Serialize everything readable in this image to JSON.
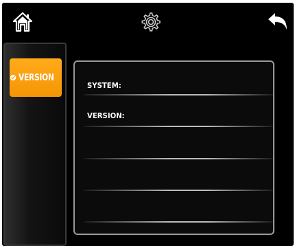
{
  "topbar": {
    "home_icon": "home-icon",
    "settings_icon": "gear-icon",
    "back_icon": "back-arrow-icon"
  },
  "sidebar": {
    "items": [
      {
        "label": "VERSION",
        "icon": "check-badge-icon",
        "selected": true
      }
    ]
  },
  "panel": {
    "rows": [
      {
        "label": "SYSTEM:",
        "value": ""
      },
      {
        "label": "VERSION:",
        "value": ""
      }
    ]
  },
  "colors": {
    "accent": "#f59e0b",
    "background": "#000000",
    "panel_border": "#9a9a9a",
    "text": "#ffffff"
  }
}
